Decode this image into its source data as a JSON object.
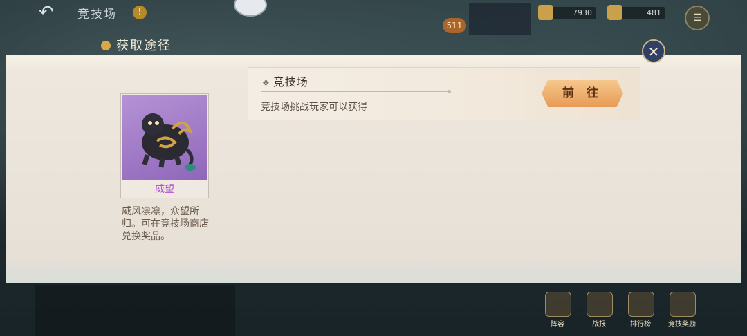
{
  "topbar": {
    "title": "竞技场",
    "level": "511",
    "resource1": "7930",
    "resource2": "481"
  },
  "panel": {
    "header": "获取途径"
  },
  "item": {
    "name": "威望",
    "description": "威风凛凛，众望所归。可在竞技场商店兑换奖品。"
  },
  "sources": [
    {
      "title": "竞技场",
      "description": "竞技场挑战玩家可以获得",
      "button": "前 往"
    }
  ],
  "nav": [
    {
      "label": "阵容"
    },
    {
      "label": "战报"
    },
    {
      "label": "排行榜"
    },
    {
      "label": "竞技奖励"
    }
  ],
  "colors": {
    "panel_bg": "#efe8df",
    "item_name": "#b84fd3",
    "go_button": "#e89a55",
    "close_button": "#2f3f66"
  }
}
